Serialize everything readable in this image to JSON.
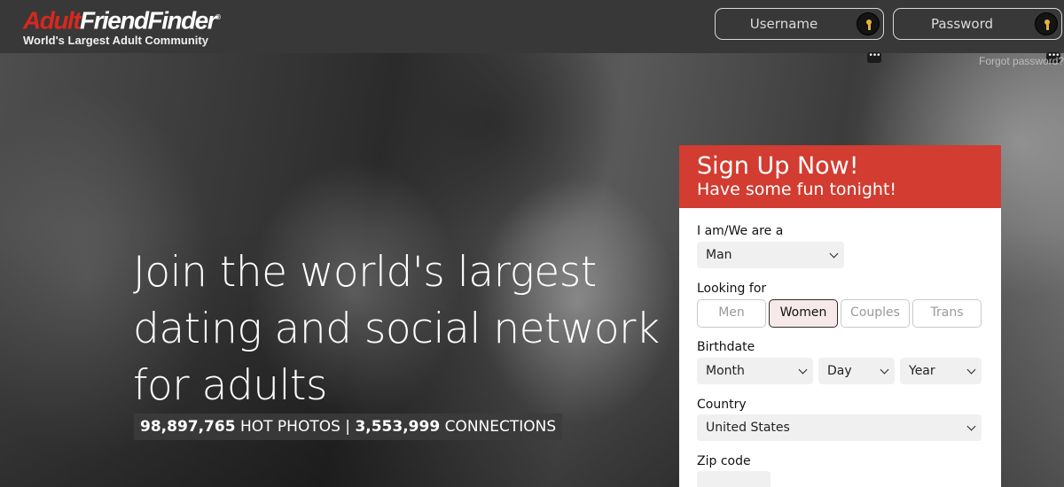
{
  "header": {
    "logo": {
      "adult": "Adult",
      "friendfinder": "FriendFinder",
      "registered": "®"
    },
    "tagline": "World's Largest Adult Community",
    "username_placeholder": "Username",
    "password_placeholder": "Password",
    "forgot_password": "Forgot password?",
    "key_icon_color": "#e3b23c"
  },
  "hero": {
    "headline_line1": "Join the world's largest",
    "headline_line2": "dating and social network",
    "headline_line3": "for adults",
    "photos_count": "98,897,765",
    "photos_label": "HOT PHOTOS",
    "separator": "|",
    "connections_count": "3,553,999",
    "connections_label": "CONNECTIONS"
  },
  "signup": {
    "title": "Sign Up Now!",
    "subtitle": "Have some fun tonight!",
    "header_color": "#d23c31",
    "iam_label": "I am/We are a",
    "iam_value": "Man",
    "looking_label": "Looking for",
    "looking_options": [
      "Men",
      "Women",
      "Couples",
      "Trans"
    ],
    "looking_selected": "Women",
    "birthdate_label": "Birthdate",
    "month_value": "Month",
    "day_value": "Day",
    "year_value": "Year",
    "country_label": "Country",
    "country_value": "United States",
    "zip_label": "Zip code"
  }
}
